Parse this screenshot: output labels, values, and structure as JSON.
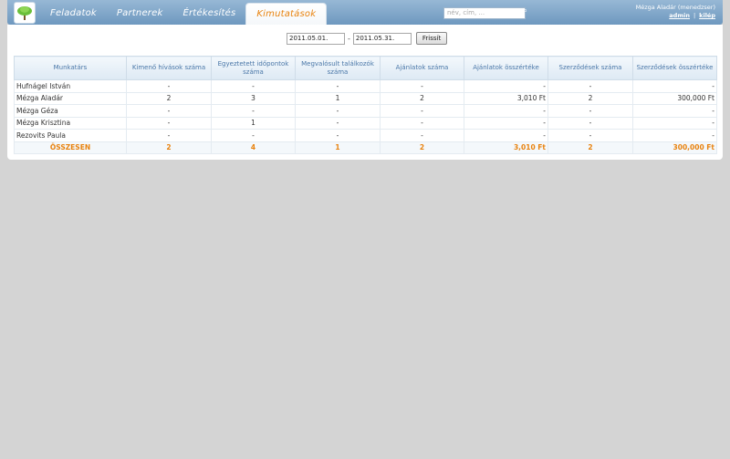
{
  "nav": {
    "tabs": [
      {
        "label": "Feladatok",
        "active": false
      },
      {
        "label": "Partnerek",
        "active": false
      },
      {
        "label": "Értékesítés",
        "active": false
      },
      {
        "label": "Kimutatások",
        "active": true
      }
    ]
  },
  "search": {
    "placeholder": "név, cím, ..."
  },
  "user": {
    "name": "Mézga Aladár (menedzser)",
    "admin": "admin",
    "separator": "|",
    "logout": "kilép"
  },
  "filter": {
    "date_from": "2011.05.01.",
    "separator": "-",
    "date_to": "2011.05.31.",
    "refresh": "Frissít"
  },
  "table": {
    "headers": [
      "Munkatárs",
      "Kimenő hívások száma",
      "Egyeztetett időpontok száma",
      "Megvalósult találkozók száma",
      "Ajánlatok száma",
      "Ajánlatok összértéke",
      "Szerződések száma",
      "Szerződések összértéke"
    ],
    "rows": [
      [
        "Hufnágel István",
        "-",
        "-",
        "-",
        "-",
        "-",
        "-",
        "-"
      ],
      [
        "Mézga Aladár",
        "2",
        "3",
        "1",
        "2",
        "3,010 Ft",
        "2",
        "300,000 Ft"
      ],
      [
        "Mézga Géza",
        "-",
        "-",
        "-",
        "-",
        "-",
        "-",
        "-"
      ],
      [
        "Mézga Krisztina",
        "-",
        "1",
        "-",
        "-",
        "-",
        "-",
        "-"
      ],
      [
        "Rezovits Paula",
        "-",
        "-",
        "-",
        "-",
        "-",
        "-",
        "-"
      ]
    ],
    "total": [
      "ÖSSZESEN",
      "2",
      "4",
      "1",
      "2",
      "3,010 Ft",
      "2",
      "300,000 Ft"
    ]
  },
  "colors": {
    "accent": "#e8820e",
    "header_bar": "#6e98bf",
    "header_text": "#4a77a8",
    "background": "#d4d4d4"
  }
}
